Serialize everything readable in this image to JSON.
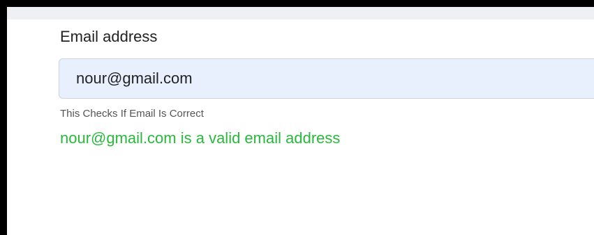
{
  "form": {
    "email_label": "Email address",
    "email_value": "nour@gmail.com",
    "help_text": "This Checks If Email Is Correct",
    "validation_message": "nour@gmail.com is a valid email address"
  },
  "colors": {
    "input_background": "#e8f0fe",
    "success_text": "#2ab73e",
    "help_text": "#555555"
  }
}
